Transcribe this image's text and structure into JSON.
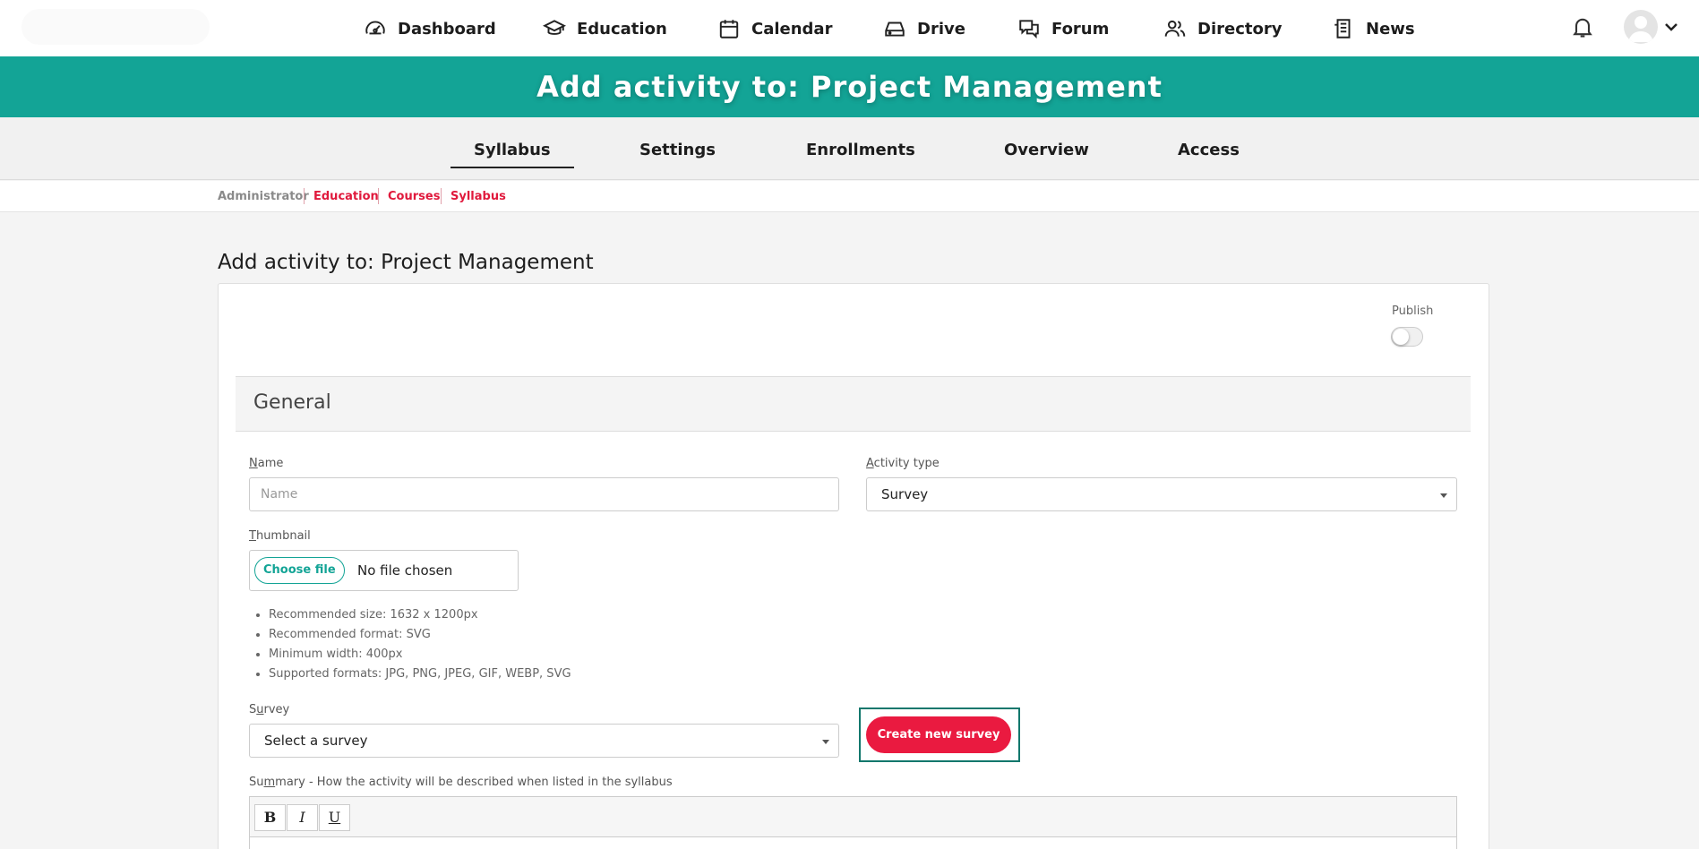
{
  "nav": {
    "items": [
      {
        "label": "Dashboard",
        "icon": "gauge-icon"
      },
      {
        "label": "Education",
        "icon": "graduation-cap-icon"
      },
      {
        "label": "Calendar",
        "icon": "calendar-icon"
      },
      {
        "label": "Drive",
        "icon": "drive-icon"
      },
      {
        "label": "Forum",
        "icon": "chat-bubbles-icon"
      },
      {
        "label": "Directory",
        "icon": "users-icon"
      },
      {
        "label": "News",
        "icon": "newspaper-icon"
      }
    ]
  },
  "banner": {
    "title": "Add activity to: Project Management"
  },
  "tabs": [
    {
      "label": "Syllabus",
      "active": true
    },
    {
      "label": "Settings"
    },
    {
      "label": "Enrollments"
    },
    {
      "label": "Overview"
    },
    {
      "label": "Access"
    }
  ],
  "breadcrumb": [
    "Administrator",
    "Education",
    "Courses",
    "Syllabus"
  ],
  "page": {
    "title": "Add activity to: Project Management"
  },
  "form": {
    "publish_label": "Publish",
    "publish_on": false,
    "section_title": "General",
    "name": {
      "label_first": "N",
      "label_rest": "ame",
      "value": "",
      "placeholder": "Name"
    },
    "activity_type": {
      "label_first": "A",
      "label_rest": "ctivity type",
      "value": "Survey"
    },
    "thumbnail": {
      "label_first": "T",
      "label_rest": "humbnail",
      "choose_label": "Choose file",
      "status": "No file chosen",
      "hints": [
        "Recommended size: 1632 x 1200px",
        "Recommended format: SVG",
        "Minimum width: 400px",
        "Supported formats: JPG, PNG, JPEG, GIF, WEBP, SVG"
      ]
    },
    "survey": {
      "label_first": "S",
      "label_u": "u",
      "label_rest": "rvey",
      "value": "Select a survey"
    },
    "create_survey_label": "Create new survey",
    "summary": {
      "label_first": "Su",
      "label_u": "m",
      "label_rest": "mary - How the activity will be described when listed in the syllabus"
    },
    "editor_buttons": [
      "B",
      "I",
      "U"
    ]
  },
  "colors": {
    "accent": "#13a496",
    "brand_red": "#ea1a40",
    "focus": "#12776c"
  }
}
